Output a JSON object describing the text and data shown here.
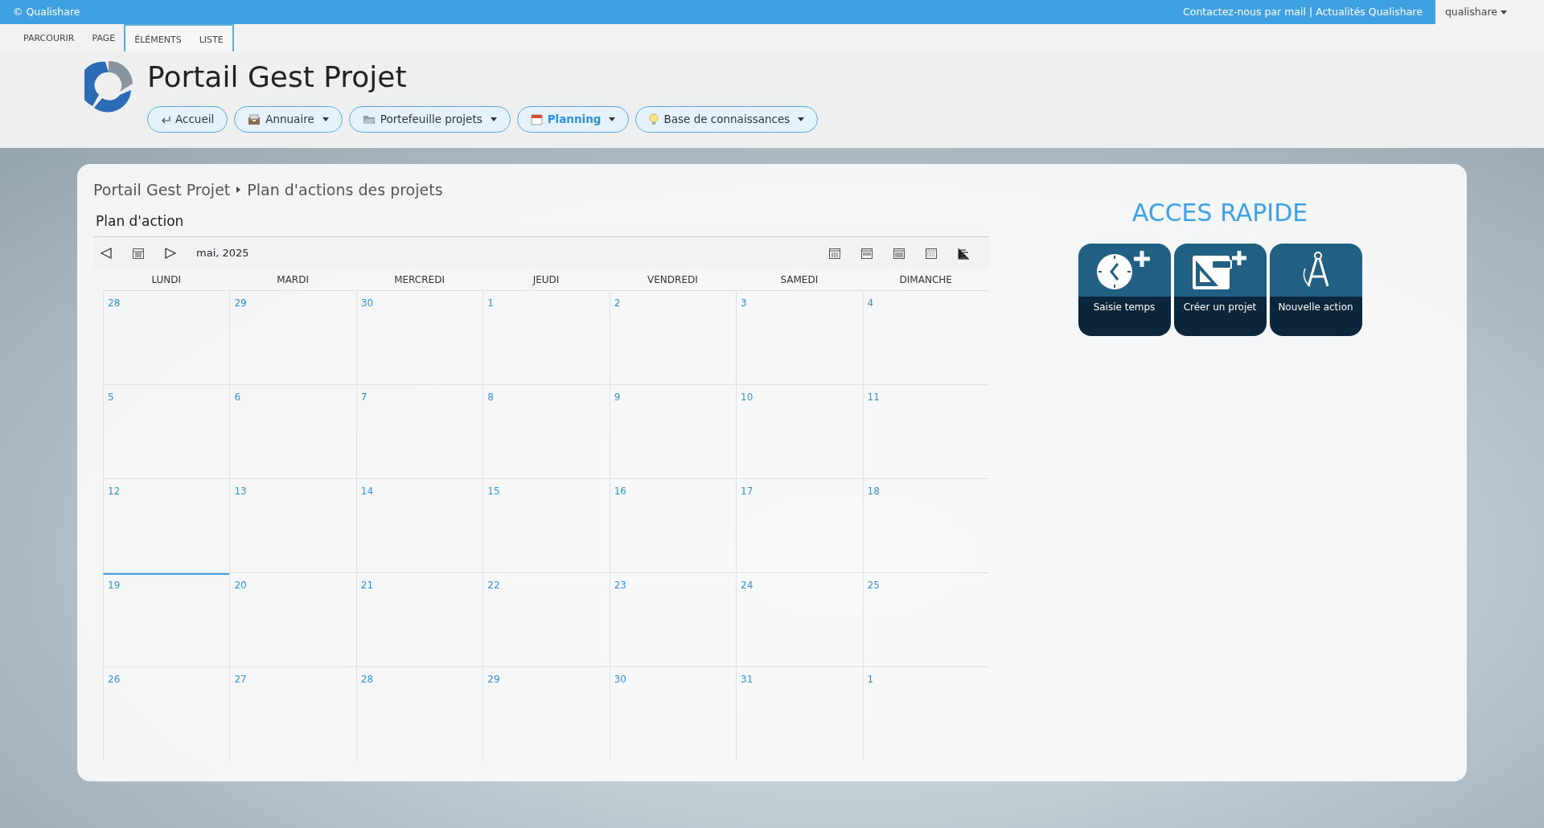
{
  "top_bar": {
    "brand": "© Qualishare",
    "links": [
      "Contactez-nous par mail",
      "Actualités Qualishare"
    ],
    "link_separator": "|",
    "user_menu": "qualishare"
  },
  "ribbon_tabs": [
    {
      "label": "PARCOURIR",
      "contextual": false
    },
    {
      "label": "PAGE",
      "contextual": false
    },
    {
      "label": "ÉLÉMENTS",
      "contextual": true
    },
    {
      "label": "LISTE",
      "contextual": true
    }
  ],
  "site_title": "Portail Gest Projet",
  "nav_buttons": [
    {
      "label": "Accueil",
      "dropdown": false,
      "selected": false
    },
    {
      "label": "Annuaire",
      "dropdown": true,
      "selected": false
    },
    {
      "label": "Portefeuille projets",
      "dropdown": true,
      "selected": false
    },
    {
      "label": "Planning",
      "dropdown": true,
      "selected": true
    },
    {
      "label": "Base de connaissances",
      "dropdown": true,
      "selected": false
    }
  ],
  "breadcrumb": [
    "Portail Gest Projet",
    "Plan d'actions des projets"
  ],
  "calendar": {
    "title": "Plan d'action",
    "month": "mai, 2025",
    "weekdays": [
      "LUNDI",
      "MARDI",
      "MERCREDI",
      "JEUDI",
      "VENDREDI",
      "SAMEDI",
      "DIMANCHE"
    ],
    "weeks": [
      [
        {
          "day": "28",
          "today": false
        },
        {
          "day": "29",
          "today": false
        },
        {
          "day": "30",
          "today": false
        },
        {
          "day": "1",
          "today": false
        },
        {
          "day": "2",
          "today": false
        },
        {
          "day": "3",
          "today": false
        },
        {
          "day": "4",
          "today": false
        }
      ],
      [
        {
          "day": "5",
          "today": false
        },
        {
          "day": "6",
          "today": false
        },
        {
          "day": "7",
          "today": false
        },
        {
          "day": "8",
          "today": false
        },
        {
          "day": "9",
          "today": false
        },
        {
          "day": "10",
          "today": false
        },
        {
          "day": "11",
          "today": false
        }
      ],
      [
        {
          "day": "12",
          "today": false
        },
        {
          "day": "13",
          "today": false
        },
        {
          "day": "14",
          "today": false
        },
        {
          "day": "15",
          "today": false
        },
        {
          "day": "16",
          "today": false
        },
        {
          "day": "17",
          "today": false
        },
        {
          "day": "18",
          "today": false
        }
      ],
      [
        {
          "day": "19",
          "today": true
        },
        {
          "day": "20",
          "today": false
        },
        {
          "day": "21",
          "today": false
        },
        {
          "day": "22",
          "today": false
        },
        {
          "day": "23",
          "today": false
        },
        {
          "day": "24",
          "today": false
        },
        {
          "day": "25",
          "today": false
        }
      ],
      [
        {
          "day": "26",
          "today": false
        },
        {
          "day": "27",
          "today": false
        },
        {
          "day": "28",
          "today": false
        },
        {
          "day": "29",
          "today": false
        },
        {
          "day": "30",
          "today": false
        },
        {
          "day": "31",
          "today": false
        },
        {
          "day": "1",
          "today": false
        }
      ]
    ]
  },
  "quick_access": {
    "title": "ACCES RAPIDE",
    "tiles": [
      "Saisie temps",
      "Créer un projet",
      "Nouvelle action"
    ]
  }
}
